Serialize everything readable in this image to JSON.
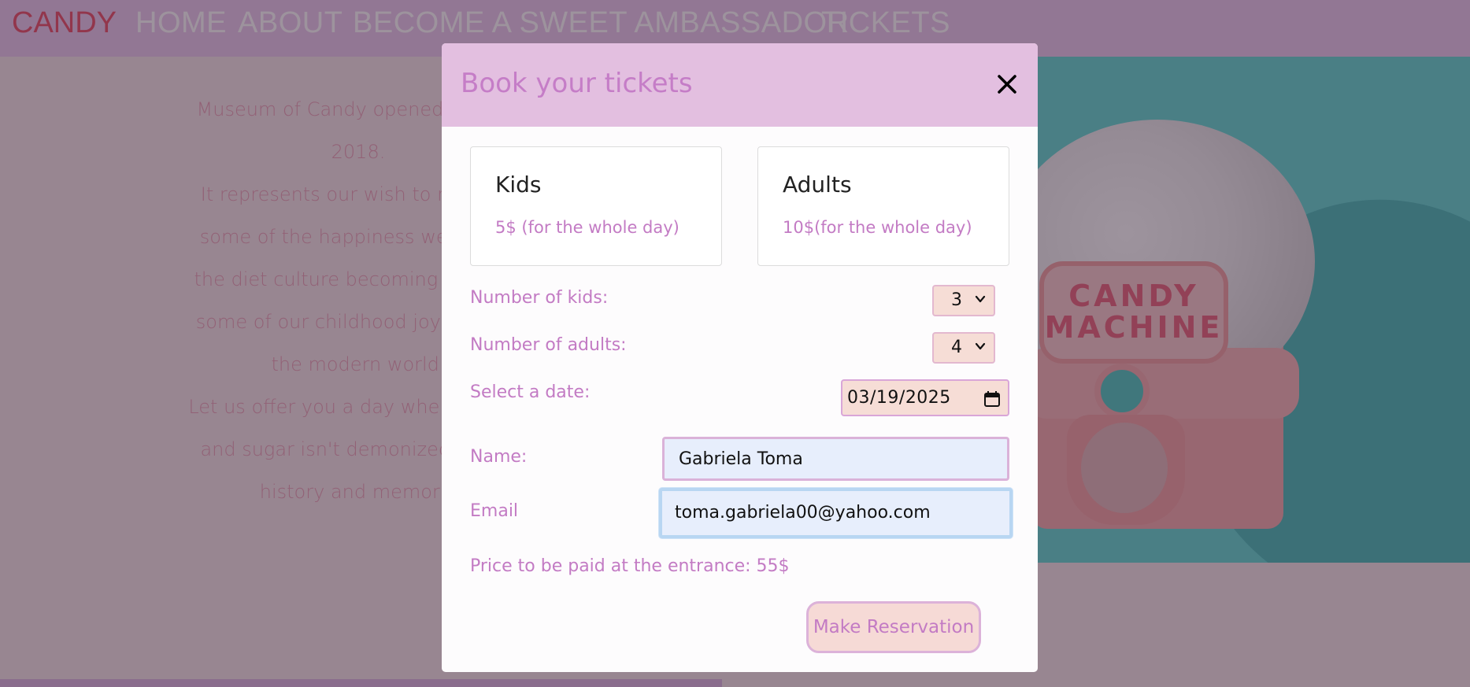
{
  "nav": {
    "brand": "CANDY",
    "links": [
      "HOME",
      "ABOUT",
      "BECOME A SWEET AMBASSADOR",
      "TICKETS"
    ]
  },
  "about": {
    "lines": [
      "Museum of Candy opened its gate",
      "2018.",
      "It represents our wish to not let a",
      "some of the happiness we had as",
      "the diet culture becoming more an",
      "some of our childhood joys becam",
      "the modern world.",
      "Let us offer you a day where calorie",
      "and sugar isn't demonized. A day",
      "history and memorie"
    ]
  },
  "hero": {
    "label_line1": "CANDY",
    "label_line2": "MACHINE"
  },
  "modal": {
    "title": "Book your tickets",
    "close_icon": "close-icon",
    "kids_card": {
      "title": "Kids",
      "price": "5$ (for the whole day)"
    },
    "adults_card": {
      "title": "Adults",
      "price": "10$(for the whole day)"
    },
    "kids_label": "Number of kids:",
    "kids_value": "3",
    "adults_label": "Number of adults:",
    "adults_value": "4",
    "date_label": "Select a date:",
    "date_value": "03/19/2025",
    "name_label": "Name:",
    "name_value": "Gabriela Toma",
    "email_label": "Email",
    "email_value": "toma.gabriela00@yahoo.com",
    "price_text": "Price to be paid at the entrance: 55$",
    "reserve_label": "Make Reservation"
  },
  "colors": {
    "accent": "#c37bc4",
    "header_bg": "#e3bfe0",
    "button_bg": "#f6dad6",
    "brand": "#e8445c"
  }
}
